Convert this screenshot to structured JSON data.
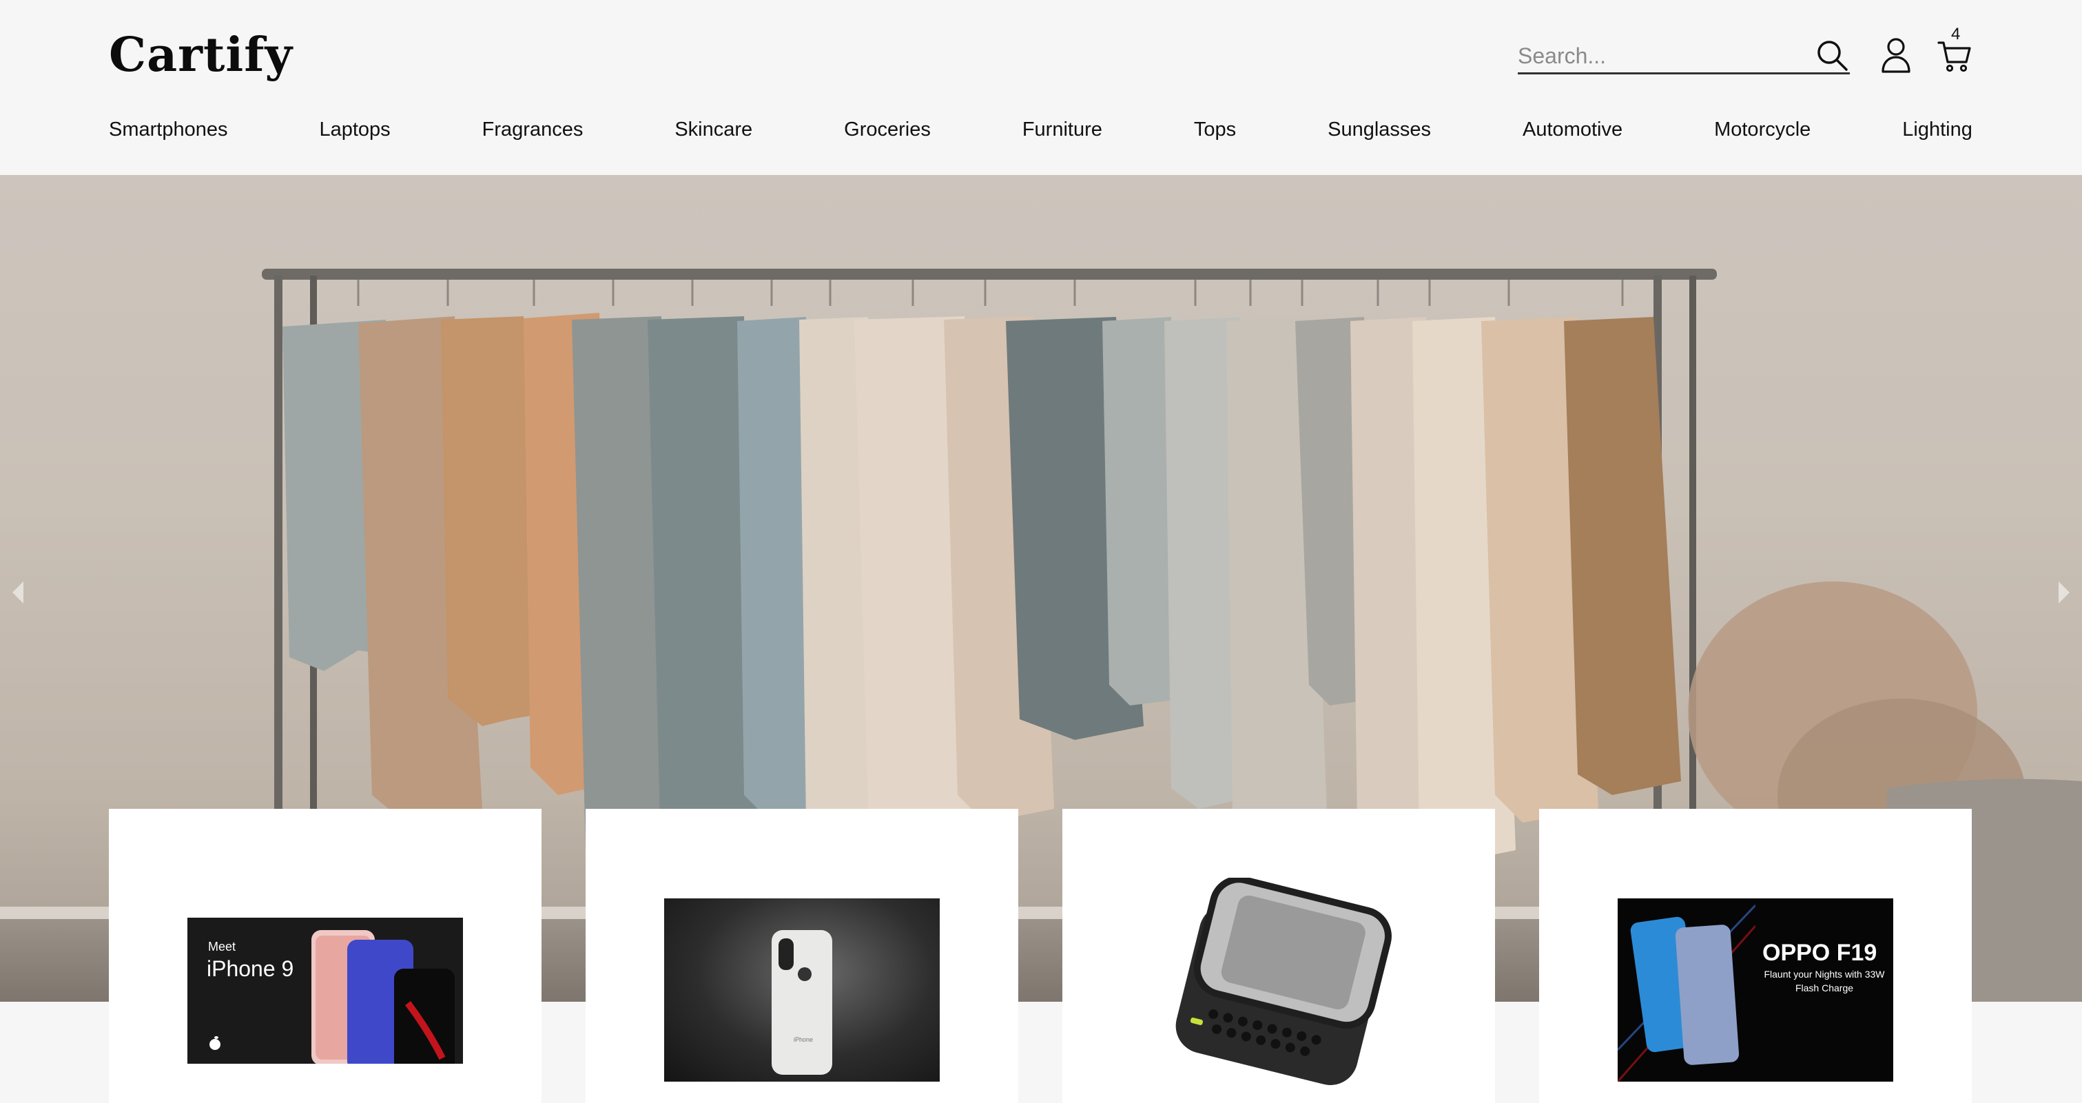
{
  "header": {
    "logo": "Cartify",
    "search_placeholder": "Search...",
    "cart_count": "4"
  },
  "nav": {
    "items": [
      "Smartphones",
      "Laptops",
      "Fragrances",
      "Skincare",
      "Groceries",
      "Furniture",
      "Tops",
      "Sunglasses",
      "Automotive",
      "Motorcycle",
      "Lighting"
    ]
  },
  "hero": {
    "icons": {
      "prev": "chevron-left-icon",
      "next": "chevron-right-icon"
    }
  },
  "products": {
    "cards": [
      {
        "image_text_small": "Meet",
        "image_text_large": "iPhone 9"
      },
      {
        "image_text_small": "iPhone"
      },
      {},
      {
        "image_text_large": "OPPO F19",
        "image_text_small": "Flaunt your Nights with 33W Flash Charge"
      }
    ]
  },
  "colors": {
    "background": "#f6f6f6",
    "card": "#ffffff",
    "text": "#111111"
  }
}
